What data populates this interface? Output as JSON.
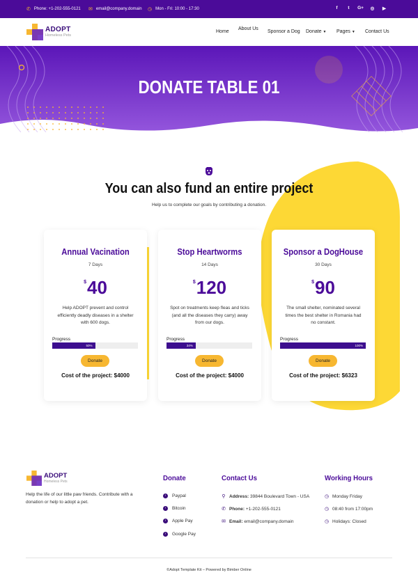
{
  "topbar": {
    "phone": "Phone: +1-202-555-0121",
    "email": "email@company.domain",
    "hours": "Mon - Fri: 10:00 - 17:30",
    "social": [
      "f",
      "t",
      "G+",
      "◎",
      "▶"
    ]
  },
  "brand": {
    "name": "ADOPT",
    "tagline": "Homeless Pets"
  },
  "nav": {
    "items": [
      "Home",
      "About Us",
      "Sponsor a Dog",
      "Donate",
      "Pages",
      "Contact Us"
    ]
  },
  "hero": {
    "title": "DONATE TABLE 01"
  },
  "section": {
    "title": "You can also fund an entire project",
    "subtitle": "Help us to complete our goals by contributing a donation."
  },
  "cards": [
    {
      "title": "Annual Vacination",
      "days": "7 Days",
      "currency": "$",
      "amount": "40",
      "description": "Help ADOPT prevent and control efficiently deadly diseases in a shelter with 600 dogs.",
      "progress_label": "Progress",
      "progress_text": "50%",
      "progress": 0.5,
      "button": "Donate",
      "cost": "Cost of the project: $4000"
    },
    {
      "title": "Stop Heartworms",
      "days": "14 Days",
      "currency": "$",
      "amount": "120",
      "description": "Spot on treatments keep fleas and ticks (and all the diseases they carry) away from our dogs.",
      "progress_label": "Progress",
      "progress_text": "34%",
      "progress": 0.34,
      "button": "Donate",
      "cost": "Cost of the project: $4000"
    },
    {
      "title": "Sponsor a DogHouse",
      "days": "30 Days",
      "currency": "$",
      "amount": "90",
      "description": "The small shelter, nominated several times the best shelter in Romania had no constant.",
      "progress_label": "Progress",
      "progress_text": "100%",
      "progress": 1.0,
      "button": "Donate",
      "cost": "Cost of the project: $6323"
    }
  ],
  "footer": {
    "description": "Help the life of our little paw friends. Contribute with a donation or help to adopt a pet.",
    "donate": {
      "heading": "Donate",
      "items": [
        "Paypal",
        "Bitcoin",
        "Apple Pay",
        "Google Pay"
      ]
    },
    "contact": {
      "heading": "Contact Us",
      "address_label": "Address:",
      "address": "39844 Boulevard Town - USA",
      "phone_label": "Phone:",
      "phone": "+1-202-555-0121",
      "email_label": "Email:",
      "email": "email@company.domain"
    },
    "hours": {
      "heading": "Working Hours",
      "items": [
        "Monday Friday",
        "08:40 from 17:00pm",
        "Holidays: Closed"
      ]
    },
    "copyright": "©Adopt Template Kit – Powered by Bimber Online"
  },
  "colors": {
    "primary": "#4b0b99",
    "accent": "#f7b731",
    "blob": "#fdd835"
  }
}
